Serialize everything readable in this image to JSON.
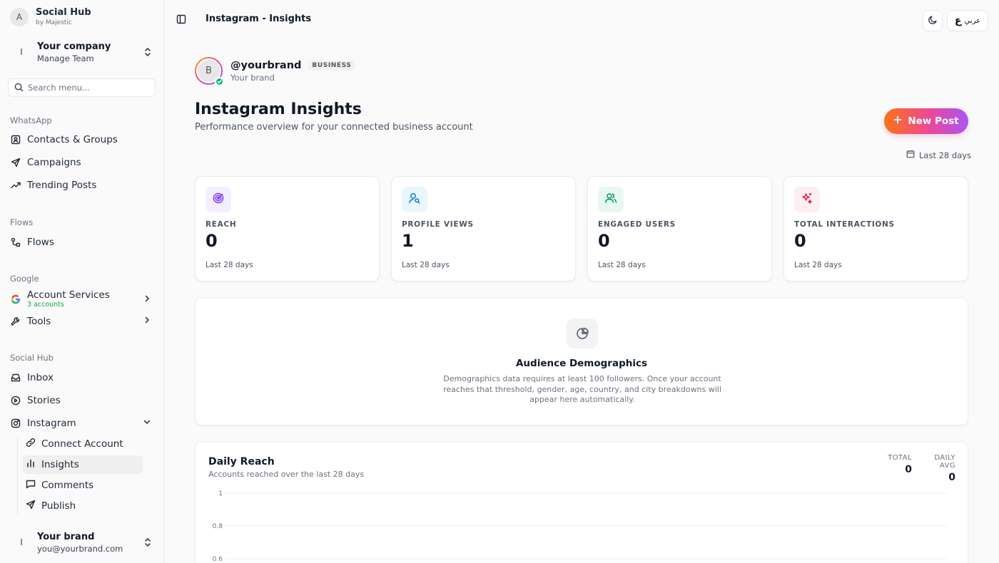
{
  "sidebar": {
    "brand_initial": "A",
    "brand_name": "Social Hub",
    "brand_sub": "by Majestic",
    "company": {
      "initial": "I",
      "name": "Your company",
      "sub": "Manage Team"
    },
    "search_placeholder": "Search menu...",
    "sections": {
      "whatsapp": "WhatsApp",
      "flows": "Flows",
      "google": "Google",
      "social": "Social Hub"
    },
    "items": {
      "contacts": "Contacts & Groups",
      "campaigns": "Campaigns",
      "trending": "Trending Posts",
      "flows": "Flows",
      "account_services": "Account Services",
      "account_services_sub": "3 accounts",
      "tools": "Tools",
      "inbox": "Inbox",
      "stories": "Stories",
      "instagram": "Instagram",
      "connect": "Connect Account",
      "insights": "Insights",
      "comments": "Comments",
      "publish": "Publish"
    },
    "user": {
      "initial": "I",
      "name": "Your brand",
      "email": "you@yourbrand.com"
    }
  },
  "topbar": {
    "title": "Instagram - Insights",
    "lang_label": "عربي"
  },
  "profile": {
    "initial": "B",
    "handle": "@yourbrand",
    "badge": "BUSINESS",
    "name": "Your brand"
  },
  "header": {
    "title": "Instagram Insights",
    "subtitle": "Performance overview for your connected business account",
    "new_post": "New Post",
    "range": "Last 28 days"
  },
  "metrics": [
    {
      "label": "REACH",
      "value": "0",
      "footer": "Last 28 days",
      "color": "#7c3aed",
      "bg": "#f3efff",
      "icon": "target-icon"
    },
    {
      "label": "PROFILE VIEWS",
      "value": "1",
      "footer": "Last 28 days",
      "color": "#0284c7",
      "bg": "#eaf6fd",
      "icon": "user-search-icon"
    },
    {
      "label": "ENGAGED USERS",
      "value": "0",
      "footer": "Last 28 days",
      "color": "#059669",
      "bg": "#e8f8f1",
      "icon": "users-icon"
    },
    {
      "label": "TOTAL INTERACTIONS",
      "value": "0",
      "footer": "Last 28 days",
      "color": "#e11d48",
      "bg": "#fdeef1",
      "icon": "sparkles-icon"
    }
  ],
  "demographics": {
    "title": "Audience Demographics",
    "text": "Demographics data requires at least 100 followers. Once your account reaches that threshold, gender, age, country, and city breakdowns will appear here automatically."
  },
  "daily_reach": {
    "title": "Daily Reach",
    "subtitle": "Accounts reached over the last 28 days",
    "total_label": "TOTAL",
    "total_value": "0",
    "avg_label": "DAILY AVG",
    "avg_value": "0"
  },
  "chart_data": {
    "type": "line",
    "title": "Daily Reach",
    "xlabel": "",
    "ylabel": "",
    "yticks": [
      "1",
      "0.8",
      "0.6"
    ],
    "ylim": [
      0,
      1
    ],
    "series": [],
    "grid": true
  }
}
